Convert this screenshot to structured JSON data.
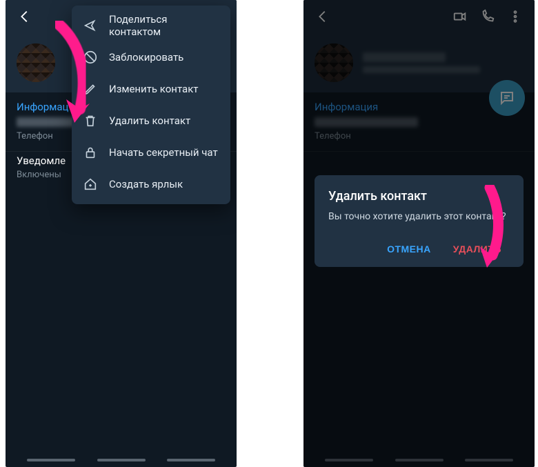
{
  "left": {
    "info_section": "Информац",
    "phone_caption": "Телефон",
    "notif_title": "Уведомле",
    "notif_value": "Включены",
    "menu": {
      "share": "Поделиться контактом",
      "block": "Заблокировать",
      "edit": "Изменить контакт",
      "delete": "Удалить контакт",
      "secret": "Начать секретный чат",
      "shortcut": "Создать ярлык"
    }
  },
  "right": {
    "info_section": "Информация",
    "phone_caption": "Телефон",
    "dialog": {
      "title": "Удалить контакт",
      "body": "Вы точно хотите удалить этот контакт?",
      "cancel": "ОТМЕНА",
      "delete": "УДАЛИТЬ"
    }
  }
}
